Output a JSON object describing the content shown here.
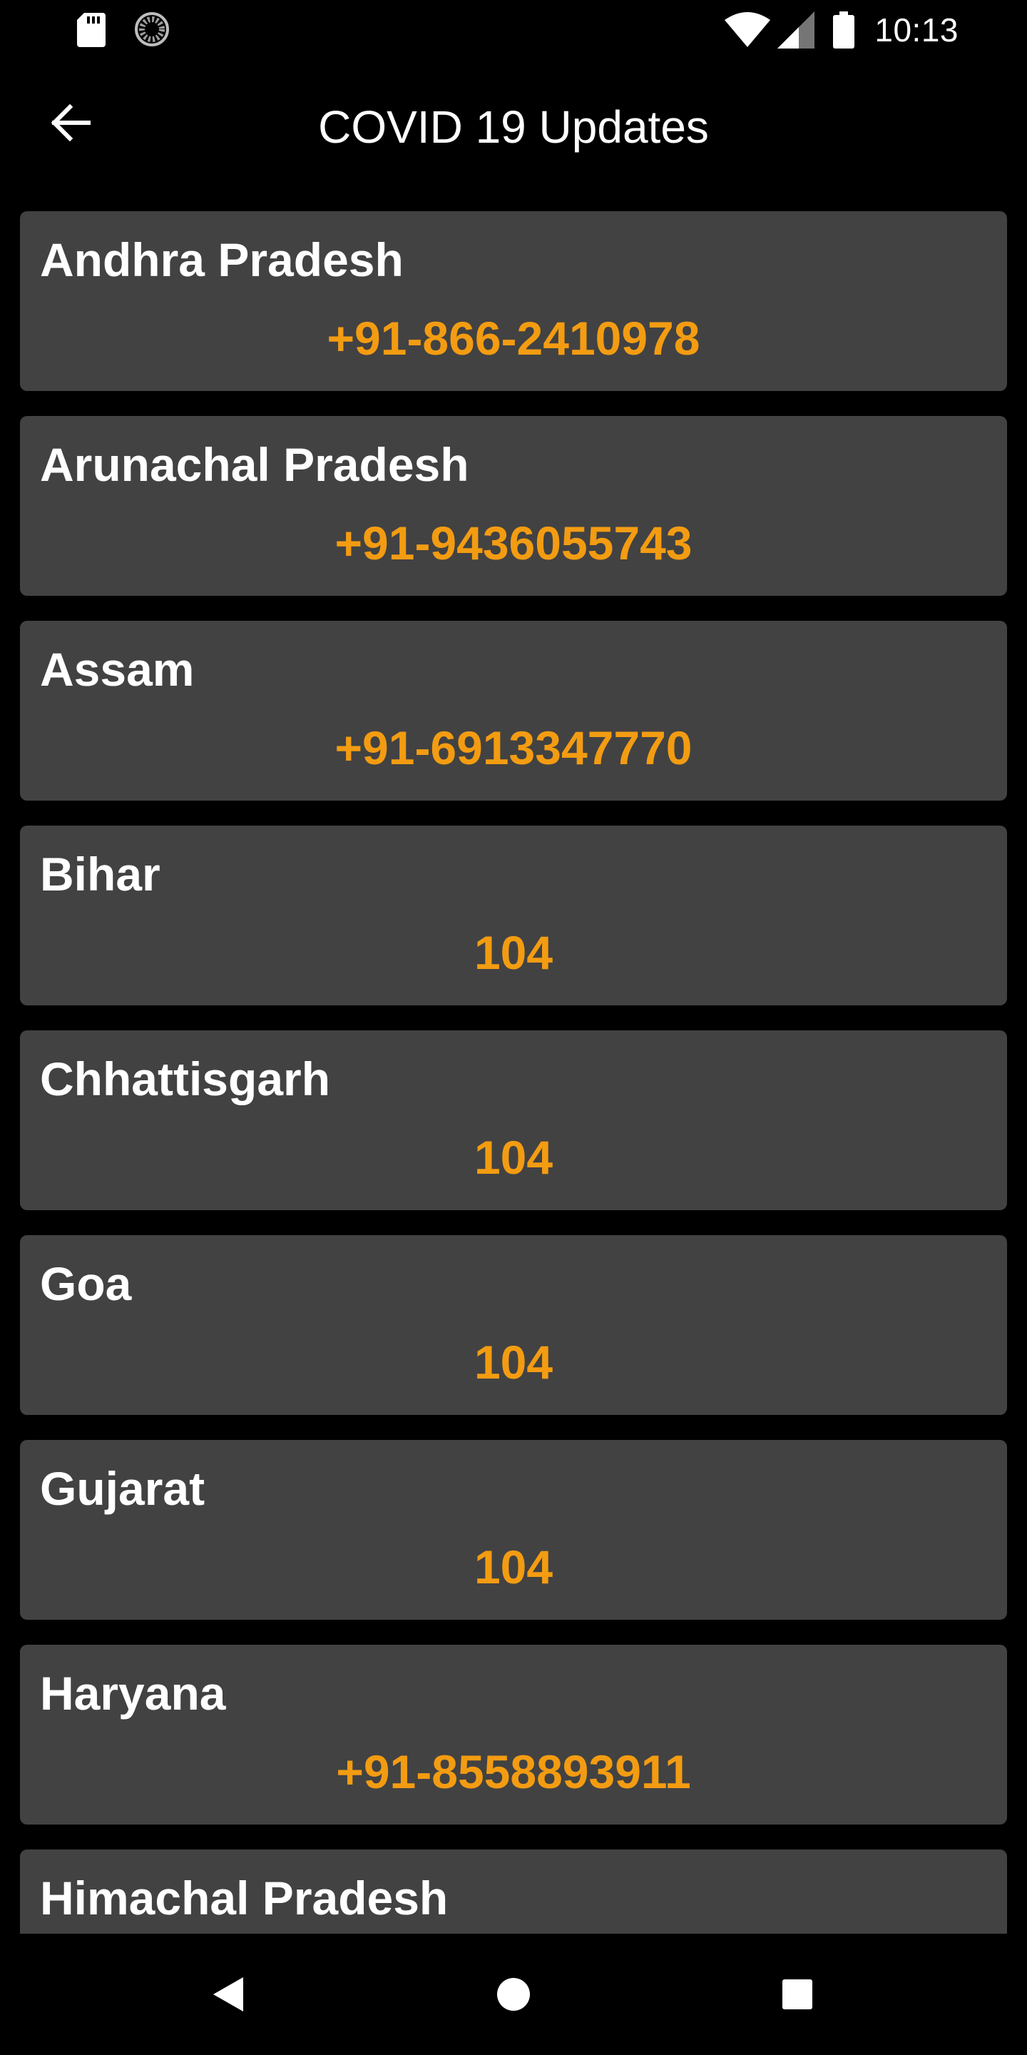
{
  "status_bar": {
    "time": "10:13",
    "icons": [
      "sd-card-icon",
      "sync-icon",
      "wifi-icon",
      "signal-icon",
      "battery-icon"
    ]
  },
  "app_bar": {
    "title": "COVID 19 Updates",
    "back_icon": "arrow-left-icon"
  },
  "colors": {
    "background": "#000000",
    "card": "#424242",
    "title_text": "#ffffff",
    "phone_text": "#f39c12"
  },
  "helplines": [
    {
      "state": "Andhra Pradesh",
      "phone": "+91-866-2410978"
    },
    {
      "state": "Arunachal Pradesh",
      "phone": "+91-9436055743"
    },
    {
      "state": "Assam",
      "phone": "+91-6913347770"
    },
    {
      "state": "Bihar",
      "phone": "104"
    },
    {
      "state": "Chhattisgarh",
      "phone": "104"
    },
    {
      "state": "Goa",
      "phone": "104"
    },
    {
      "state": "Gujarat",
      "phone": "104"
    },
    {
      "state": "Haryana",
      "phone": "+91-8558893911"
    },
    {
      "state": "Himachal Pradesh",
      "phone": ""
    }
  ],
  "nav_bar": {
    "icons": [
      "nav-back-icon",
      "nav-home-icon",
      "nav-recents-icon"
    ]
  }
}
